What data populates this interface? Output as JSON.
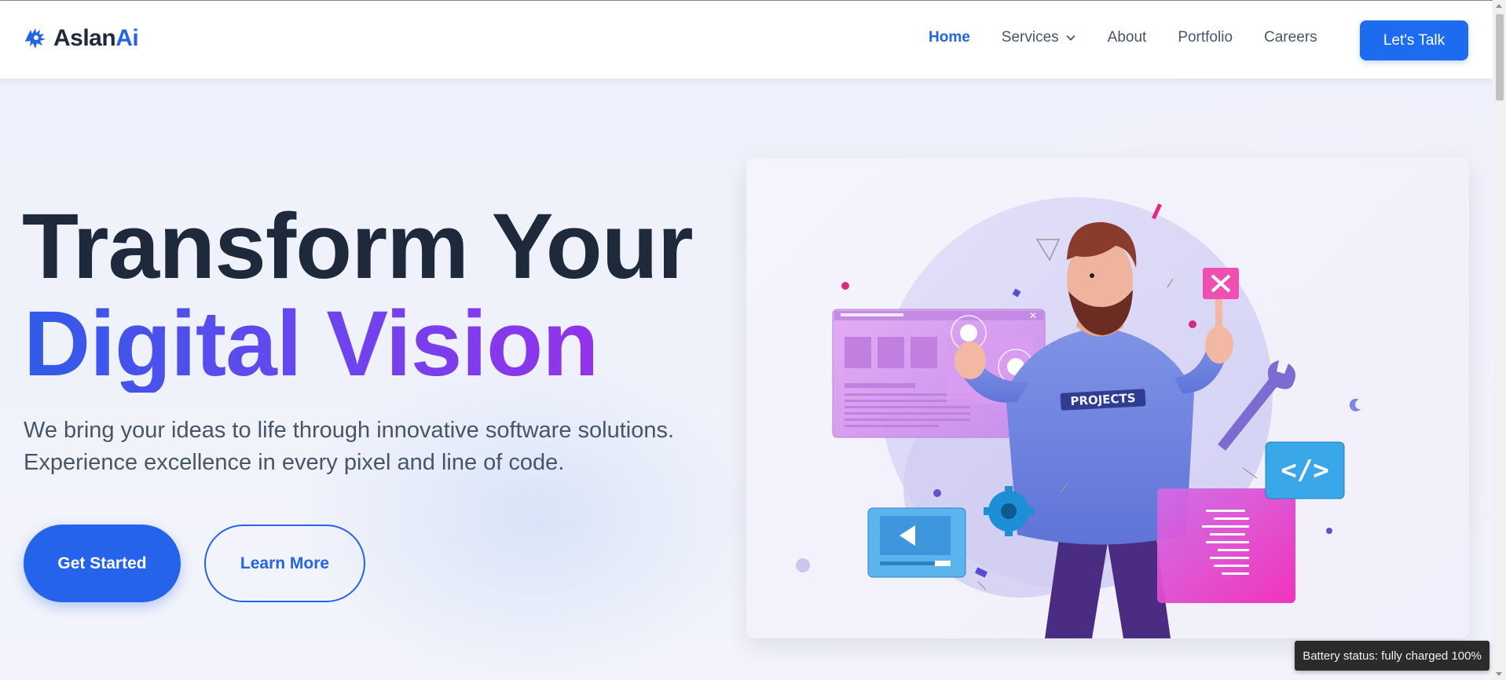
{
  "brand": {
    "name_part1": "Aslan",
    "name_part2": "Ai",
    "logo_icon": "lion-head-icon",
    "accent_color": "#2563eb"
  },
  "nav": {
    "items": [
      {
        "label": "Home",
        "active": true
      },
      {
        "label": "Services",
        "has_dropdown": true
      },
      {
        "label": "About"
      },
      {
        "label": "Portfolio"
      },
      {
        "label": "Careers"
      }
    ],
    "cta_label": "Let's Talk"
  },
  "hero": {
    "title_line1": "Transform Your",
    "title_line2": "Digital Vision",
    "subtitle": "We bring your ideas to life through innovative software solutions. Experience excellence in every pixel and line of code.",
    "primary_button": "Get Started",
    "secondary_button": "Learn More",
    "illustration": {
      "shirt_text": "PROJECTS",
      "code_panel_symbol": "</>"
    }
  },
  "tooltip": {
    "text": "Battery status: fully charged 100%"
  }
}
